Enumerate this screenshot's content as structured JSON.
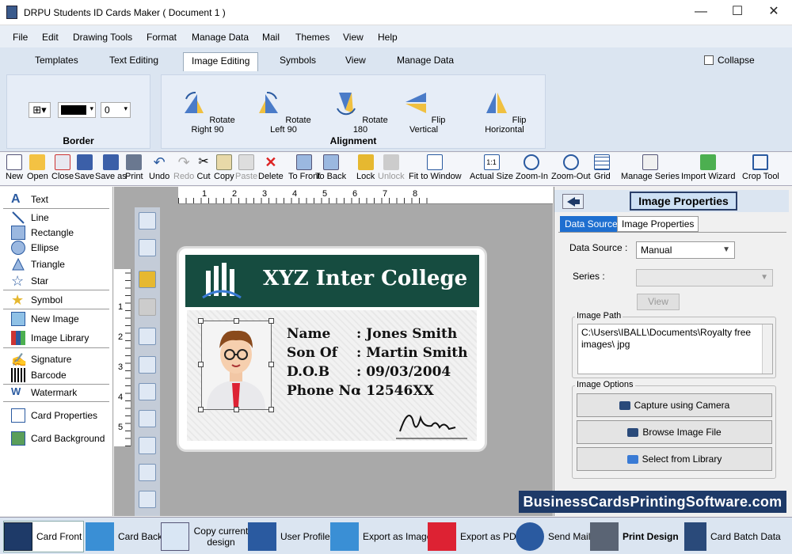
{
  "window": {
    "title": "DRPU Students ID Cards Maker ( Document 1 )",
    "minimize": "—",
    "maximize": "☐",
    "close": "✕"
  },
  "menu": [
    "File",
    "Edit",
    "Drawing Tools",
    "Format",
    "Manage Data",
    "Mail",
    "Themes",
    "View",
    "Help"
  ],
  "ribbon_tabs": [
    "Templates",
    "Text Editing",
    "Image Editing",
    "Symbols",
    "View",
    "Manage Data"
  ],
  "collapse_label": "Collapse",
  "border_group": {
    "label": "Border",
    "width_value": "0"
  },
  "alignment_group": {
    "label": "Alignment",
    "buttons": [
      "Rotate Right 90",
      "Rotate Left 90",
      "Rotate 180",
      "Flip Vertical",
      "Flip Horizontal"
    ]
  },
  "toolbar": [
    "New",
    "Open",
    "Close",
    "Save",
    "Save as",
    "Print",
    "Undo",
    "Redo",
    "Cut",
    "Copy",
    "Paste",
    "Delete",
    "To Front",
    "To Back",
    "Lock",
    "Unlock",
    "Fit to Window",
    "Actual Size",
    "Zoom-In",
    "Zoom-Out",
    "Grid",
    "Manage Series",
    "Import Wizard",
    "Crop Tool"
  ],
  "left_panel": [
    "Text",
    "Line",
    "Rectangle",
    "Ellipse",
    "Triangle",
    "Star",
    "Symbol",
    "New Image",
    "Image Library",
    "Signature",
    "Barcode",
    "Watermark",
    "Card Properties",
    "Card Background"
  ],
  "ruler": {
    "top": [
      "1",
      "2",
      "3",
      "4",
      "5",
      "6",
      "7",
      "8"
    ],
    "left": [
      "1",
      "2",
      "3",
      "4",
      "5"
    ]
  },
  "card": {
    "title": "XYZ Inter College",
    "rows": [
      {
        "label": "Name",
        "value": ": Jones Smith"
      },
      {
        "label": "Son Of",
        "value": ": Martin Smith"
      },
      {
        "label": "D.O.B",
        "value": ": 09/03/2004"
      },
      {
        "label": "Phone No",
        "value": ": 12546XX"
      }
    ],
    "header_color": "#164c40"
  },
  "right_panel": {
    "title": "Image Properties",
    "tabs": [
      "Data Source",
      "Image Properties"
    ],
    "data_source_label": "Data Source :",
    "data_source_value": "Manual",
    "series_label": "Series :",
    "view_button": "View",
    "image_path_label": "Image Path",
    "image_path": "C:\\Users\\IBALL\\Documents\\Royalty free images\\ jpg",
    "image_options_label": "Image Options",
    "buttons": [
      "Capture using Camera",
      "Browse Image File",
      "Select from Library"
    ]
  },
  "watermark": "BusinessCardsPrintingSoftware.com",
  "bottom_bar": [
    "Card Front",
    "Card Back",
    "Copy current design",
    "User Profile",
    "Export as Image",
    "Export as PDF",
    "Send Mail",
    "Print Design",
    "Card Batch Data"
  ]
}
